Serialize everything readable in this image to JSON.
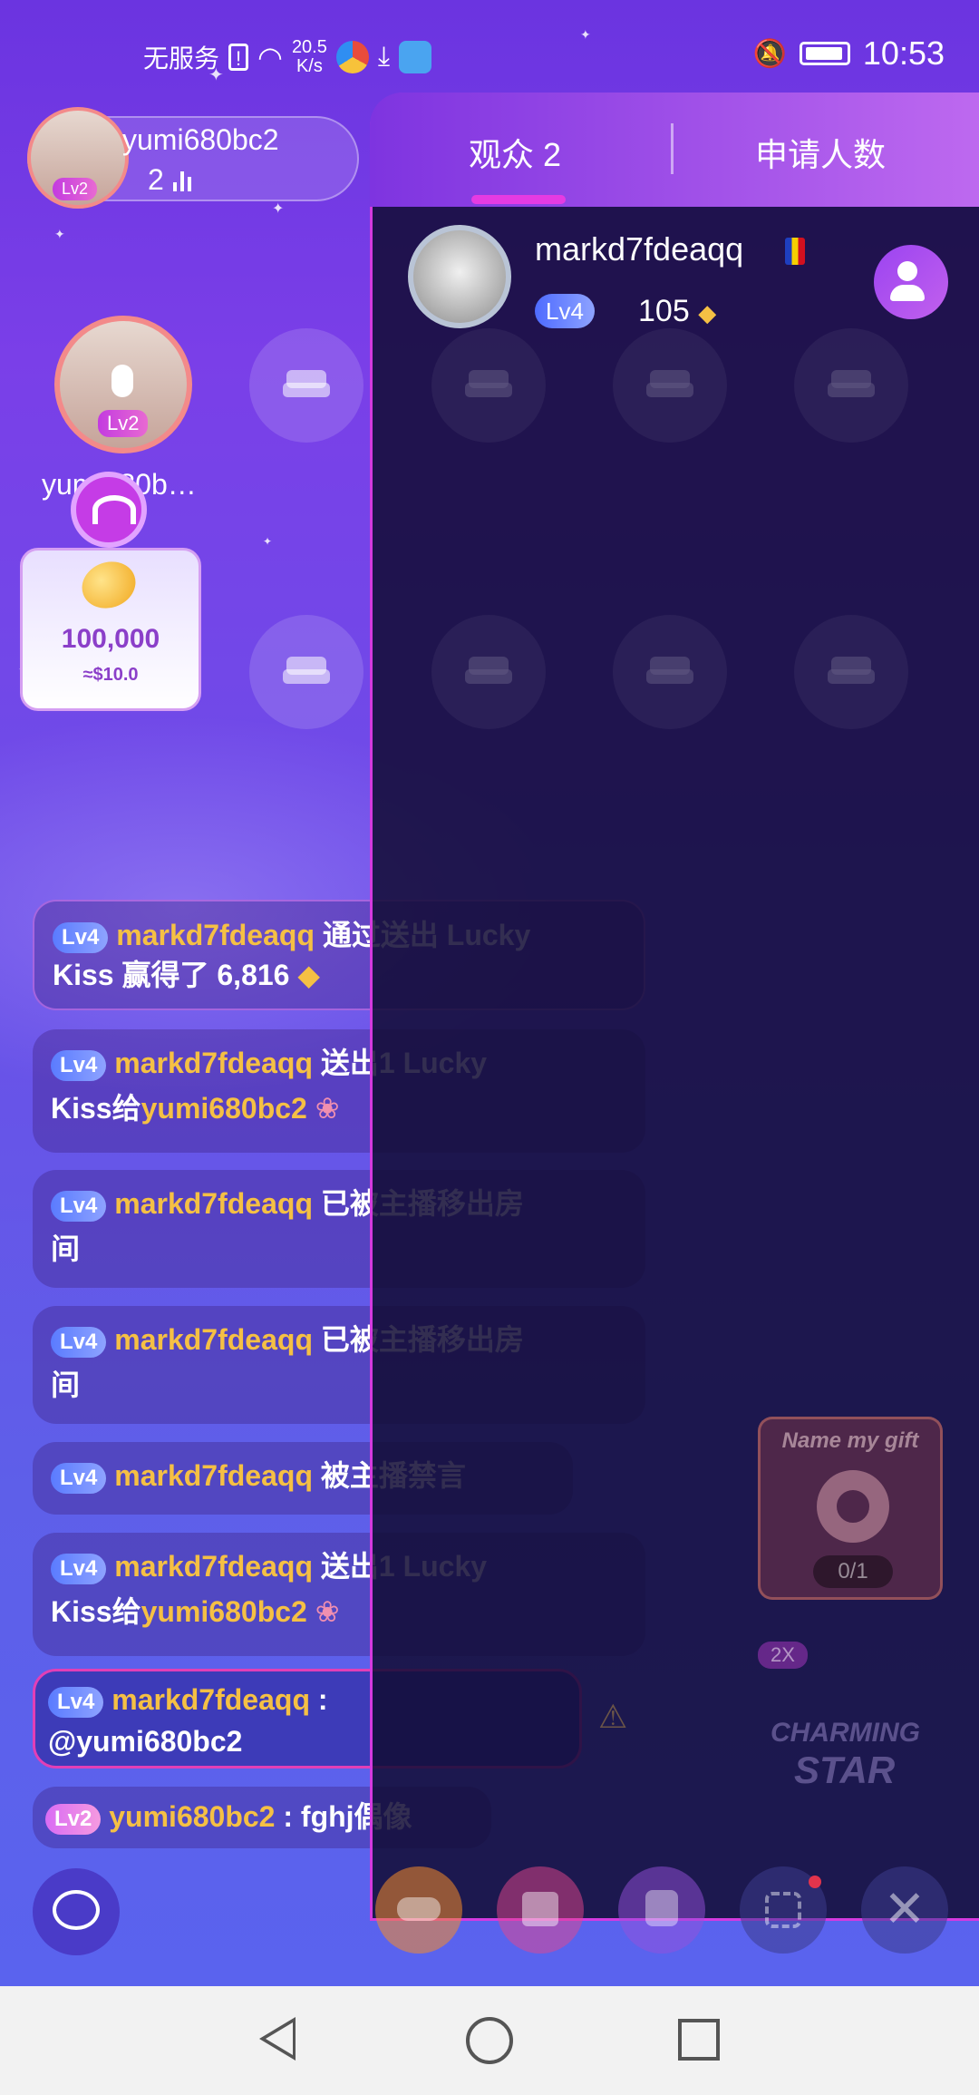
{
  "status_bar": {
    "carrier": "无服务",
    "net_speed_value": "20.5",
    "net_speed_unit": "K/s",
    "time": "10:53"
  },
  "host": {
    "name": "yumi680bc2",
    "viewers": "2",
    "level": "Lv2"
  },
  "mic": {
    "name": "yumi680b…",
    "level": "Lv2"
  },
  "lucky_box": {
    "value": "100,000",
    "usd": "≈$10.0"
  },
  "chat": [
    {
      "level": "Lv4",
      "user": "markd7fdeaqq",
      "text": "通过送出 Lucky",
      "text2": "Kiss 赢得了 6,816"
    },
    {
      "level": "Lv4",
      "user": "markd7fdeaqq",
      "text": "送出1 Lucky",
      "text2_prefix": "Kiss给",
      "text2_user": "yumi680bc2"
    },
    {
      "level": "Lv4",
      "user": "markd7fdeaqq",
      "text": "已被主播移出房",
      "text2": "间"
    },
    {
      "level": "Lv4",
      "user": "markd7fdeaqq",
      "text": "已被主播移出房",
      "text2": "间"
    },
    {
      "level": "Lv4",
      "user": "markd7fdeaqq",
      "text": "被主播禁言"
    },
    {
      "level": "Lv4",
      "user": "markd7fdeaqq",
      "text": "送出1 Lucky",
      "text2_prefix": "Kiss给",
      "text2_user": "yumi680bc2"
    },
    {
      "level": "Lv4",
      "user": "markd7fdeaqq",
      "text": ":",
      "text2": "@yumi680bc2"
    },
    {
      "level": "Lv2",
      "user": "yumi680bc2",
      "text": ": fghj偶像"
    }
  ],
  "gift_promo": {
    "title": "Name my gift",
    "progress": "0/1"
  },
  "charming_star": {
    "multiplier": "2X",
    "line1": "CHARMING",
    "line2": "STAR"
  },
  "drawer": {
    "tab_audience": "观众 2",
    "tab_applicants": "申请人数",
    "viewer": {
      "name": "markd7fdeaqq",
      "level": "Lv4",
      "points": "105"
    }
  },
  "colors": {
    "accent": "#e53be2",
    "username": "#f5c044",
    "drawer_bg": "#120c34"
  }
}
